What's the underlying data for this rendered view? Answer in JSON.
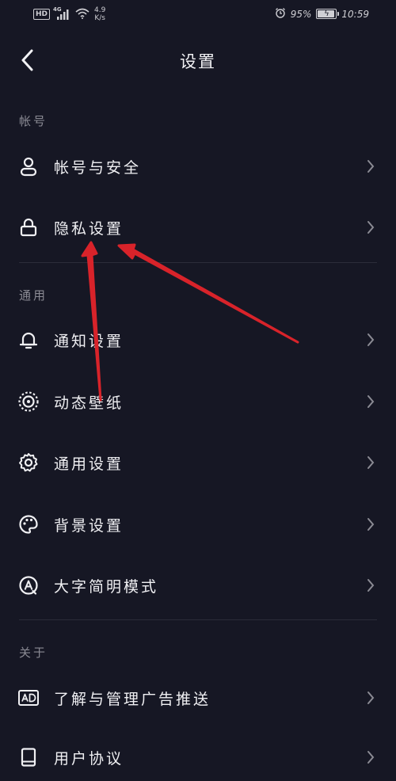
{
  "status_bar": {
    "hd": "HD",
    "network": "4G",
    "speed_value": "4.9",
    "speed_unit": "K/s",
    "battery_percent": "95%",
    "battery_level": 0.95,
    "time": "10:59"
  },
  "header": {
    "title": "设置"
  },
  "sections": {
    "account": {
      "label": "帐号",
      "items": [
        {
          "label": "帐号与安全",
          "icon": "user-icon"
        },
        {
          "label": "隐私设置",
          "icon": "lock-icon"
        }
      ]
    },
    "general": {
      "label": "通用",
      "items": [
        {
          "label": "通知设置",
          "icon": "bell-icon"
        },
        {
          "label": "动态壁纸",
          "icon": "live-wallpaper-icon"
        },
        {
          "label": "通用设置",
          "icon": "gear-icon"
        },
        {
          "label": "背景设置",
          "icon": "palette-icon"
        },
        {
          "label": "大字简明模式",
          "icon": "large-text-icon"
        }
      ]
    },
    "about": {
      "label": "关于",
      "items": [
        {
          "label": "了解与管理广告推送",
          "icon": "ad-icon"
        },
        {
          "label": "用户协议",
          "icon": "book-icon"
        }
      ]
    }
  },
  "annotation": {
    "color": "#d8232a"
  }
}
